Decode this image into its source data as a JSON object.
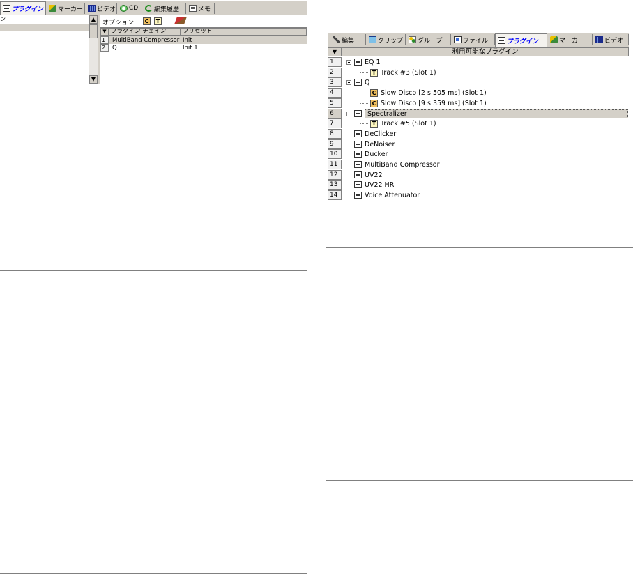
{
  "left_window": {
    "tabs": [
      {
        "label": "プラグイン",
        "icon": "plug-icon"
      },
      {
        "label": "マーカー",
        "icon": "marker-icon"
      },
      {
        "label": "ビデオ",
        "icon": "video-icon"
      },
      {
        "label": "CD",
        "icon": "cd-icon"
      },
      {
        "label": "編集履歴",
        "icon": "history-icon"
      },
      {
        "label": "メモ",
        "icon": "memo-icon"
      }
    ],
    "left_panel_header": "ン",
    "toolbar": {
      "options_label": "オプション",
      "c_button": "C",
      "t_button": "T"
    },
    "chain_headers": {
      "chain": "プラグイン チェイン",
      "preset": "プリセット"
    },
    "chain_rows": [
      {
        "num": "1",
        "name": "MultiBand Compressor",
        "preset": "Init"
      },
      {
        "num": "2",
        "name": "Q",
        "preset": "Init 1"
      }
    ]
  },
  "right_window": {
    "tabs": [
      {
        "label": "編集",
        "icon": "tool-icon"
      },
      {
        "label": "クリップ",
        "icon": "clip-icon"
      },
      {
        "label": "グループ",
        "icon": "group-icon"
      },
      {
        "label": "ファイル",
        "icon": "file-icon"
      },
      {
        "label": "プラグイン",
        "icon": "plug-icon"
      },
      {
        "label": "マーカー",
        "icon": "marker-icon"
      },
      {
        "label": "ビデオ",
        "icon": "video-icon"
      }
    ],
    "column_header": "利用可能なプラグイン",
    "rows": [
      {
        "num": "1",
        "label": "EQ 1",
        "kind": "plugin",
        "expanded": true
      },
      {
        "num": "2",
        "label": "Track #3 (Slot 1)",
        "kind": "track",
        "badge": "T"
      },
      {
        "num": "3",
        "label": "Q",
        "kind": "plugin",
        "expanded": true
      },
      {
        "num": "4",
        "label": "Slow Disco [2 s 505 ms] (Slot 1)",
        "kind": "clip",
        "badge": "C"
      },
      {
        "num": "5",
        "label": "Slow Disco [9 s 359 ms] (Slot 1)",
        "kind": "clip",
        "badge": "C"
      },
      {
        "num": "6",
        "label": "Spectralizer",
        "kind": "plugin",
        "expanded": true,
        "selected": true
      },
      {
        "num": "7",
        "label": "Track #5 (Slot 1)",
        "kind": "track",
        "badge": "T"
      },
      {
        "num": "8",
        "label": "DeClicker",
        "kind": "plugin"
      },
      {
        "num": "9",
        "label": "DeNoiser",
        "kind": "plugin"
      },
      {
        "num": "10",
        "label": "Ducker",
        "kind": "plugin"
      },
      {
        "num": "11",
        "label": "MultiBand Compressor",
        "kind": "plugin"
      },
      {
        "num": "12",
        "label": "UV22",
        "kind": "plugin"
      },
      {
        "num": "13",
        "label": "UV22 HR",
        "kind": "plugin"
      },
      {
        "num": "14",
        "label": "Voice Attenuator",
        "kind": "plugin"
      }
    ]
  },
  "colors": {
    "selection": "#d4d0c8",
    "chrome": "#d4d0c8",
    "active_tab_text": "#0000ff",
    "border": "#808080"
  }
}
